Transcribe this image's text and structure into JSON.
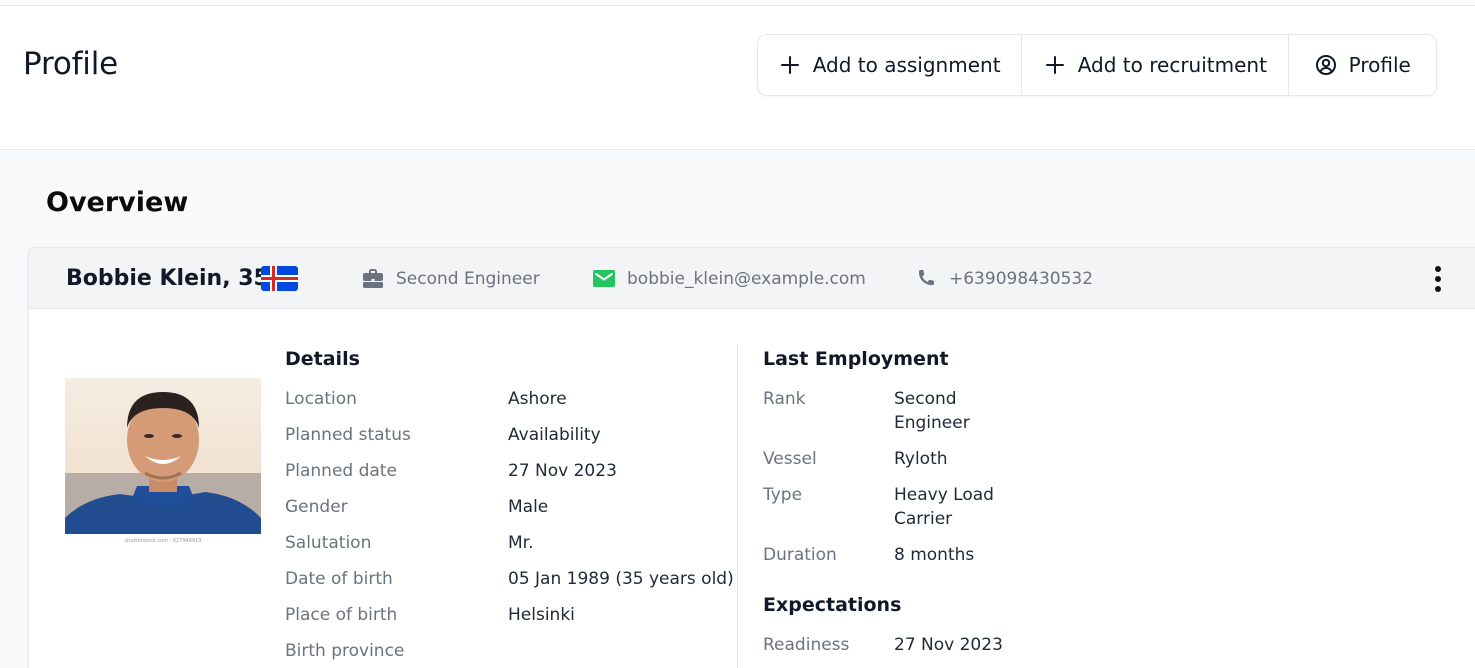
{
  "header": {
    "title": "Profile",
    "actions": [
      {
        "label": "Add to assignment",
        "icon": "plus-icon"
      },
      {
        "label": "Add to recruitment",
        "icon": "plus-icon"
      },
      {
        "label": "Profile",
        "icon": "user-circle-icon"
      }
    ]
  },
  "overview": {
    "title": "Overview",
    "person": {
      "name": "Bobbie Klein, 35",
      "flag": "iceland-flag",
      "rank": "Second Engineer",
      "email": "bobbie_klein@example.com",
      "phone": "+639098430532",
      "photo_caption": "shutterstock.com · 627946913"
    },
    "details": {
      "title": "Details",
      "rows": [
        {
          "label": "Location",
          "value": "Ashore"
        },
        {
          "label": "Planned status",
          "value": "Availability"
        },
        {
          "label": "Planned date",
          "value": "27 Nov 2023"
        },
        {
          "label": "Gender",
          "value": "Male"
        },
        {
          "label": "Salutation",
          "value": "Mr."
        },
        {
          "label": "Date of birth",
          "value": "05 Jan 1989 (35 years old)"
        },
        {
          "label": "Place of birth",
          "value": "Helsinki"
        },
        {
          "label": "Birth province",
          "value": ""
        }
      ]
    },
    "last_employment": {
      "title": "Last Employment",
      "rows": [
        {
          "label": "Rank",
          "value": "Second Engineer"
        },
        {
          "label": "Vessel",
          "value": "Ryloth"
        },
        {
          "label": "Type",
          "value": "Heavy Load Carrier"
        },
        {
          "label": "Duration",
          "value": "8 months"
        }
      ]
    },
    "expectations": {
      "title": "Expectations",
      "rows": [
        {
          "label": "Readiness",
          "value": "27 Nov 2023"
        }
      ]
    }
  },
  "colors": {
    "email_icon": "#22c55e",
    "muted_text": "#6b7280",
    "flag_blue": "#0048e0",
    "flag_red": "#d72828"
  }
}
